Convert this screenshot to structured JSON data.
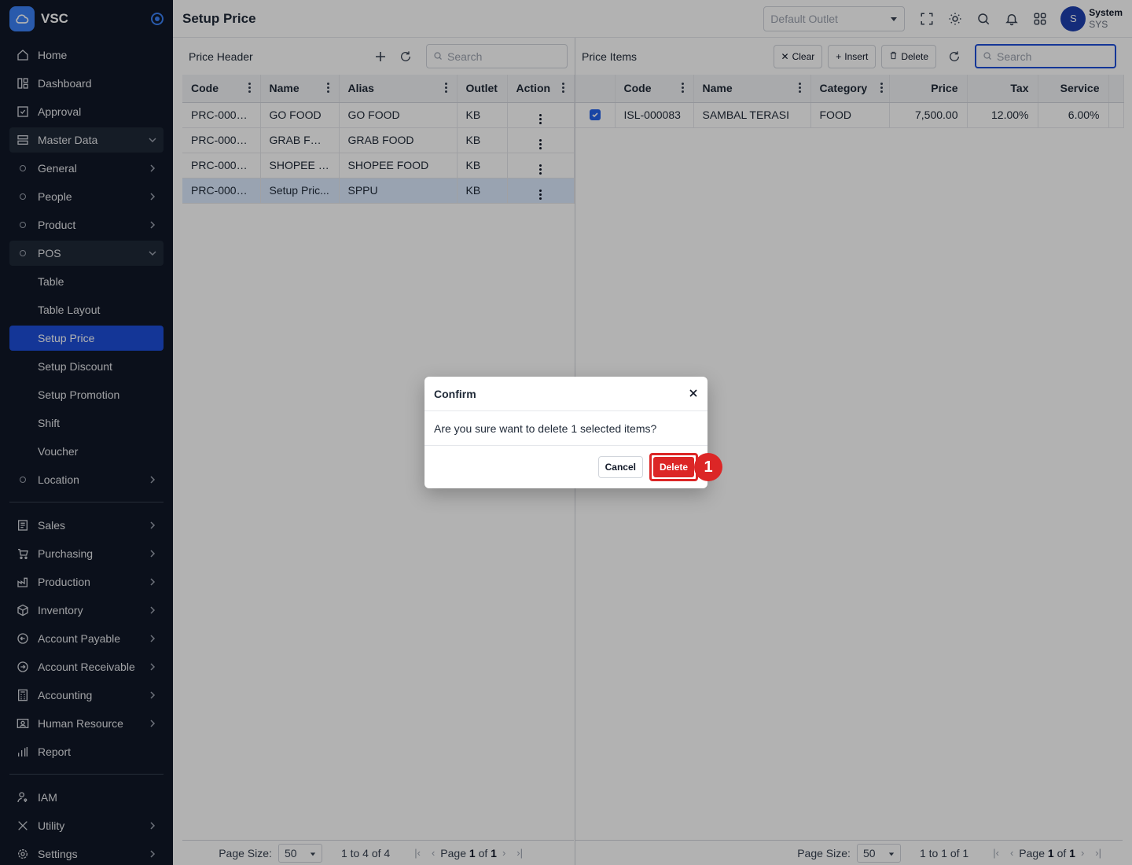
{
  "brand": {
    "name": "VSC"
  },
  "sidebar": {
    "items": [
      {
        "label": "Home",
        "icon": "home-icon"
      },
      {
        "label": "Dashboard",
        "icon": "dashboard-icon"
      },
      {
        "label": "Approval",
        "icon": "approval-icon"
      },
      {
        "label": "Master Data",
        "icon": "database-icon",
        "expanded": true
      },
      {
        "label": "General",
        "sub": true
      },
      {
        "label": "People",
        "sub": true
      },
      {
        "label": "Product",
        "sub": true
      },
      {
        "label": "POS",
        "sub": true,
        "expanded": true
      },
      {
        "label": "Table"
      },
      {
        "label": "Table Layout"
      },
      {
        "label": "Setup Price",
        "active": true
      },
      {
        "label": "Setup Discount"
      },
      {
        "label": "Setup Promotion"
      },
      {
        "label": "Shift"
      },
      {
        "label": "Voucher"
      },
      {
        "label": "Location",
        "sub": true
      }
    ],
    "modules": [
      {
        "label": "Sales",
        "icon": "sales-icon"
      },
      {
        "label": "Purchasing",
        "icon": "cart-icon"
      },
      {
        "label": "Production",
        "icon": "factory-icon"
      },
      {
        "label": "Inventory",
        "icon": "box-icon"
      },
      {
        "label": "Account Payable",
        "icon": "arrow-left-circle-icon"
      },
      {
        "label": "Account Receivable",
        "icon": "arrow-right-circle-icon"
      },
      {
        "label": "Accounting",
        "icon": "calculator-icon"
      },
      {
        "label": "Human Resource",
        "icon": "id-card-icon"
      },
      {
        "label": "Report",
        "icon": "bar-chart-icon"
      }
    ],
    "system": [
      {
        "label": "IAM",
        "icon": "user-key-icon"
      },
      {
        "label": "Utility",
        "icon": "tools-icon"
      },
      {
        "label": "Settings",
        "icon": "gear-icon"
      }
    ]
  },
  "topbar": {
    "title": "Setup Price",
    "outlet_placeholder": "Default Outlet",
    "user_initial": "S",
    "user_name": "System",
    "user_code": "SYS"
  },
  "price_header": {
    "title": "Price Header",
    "search_placeholder": "Search",
    "columns": [
      "Code",
      "Name",
      "Alias",
      "Outlet",
      "Action"
    ],
    "rows": [
      {
        "code": "PRC-0000...",
        "name": "GO FOOD",
        "alias": "GO FOOD",
        "outlet": "KB"
      },
      {
        "code": "PRC-0000...",
        "name": "GRAB FOOD",
        "alias": "GRAB FOOD",
        "outlet": "KB"
      },
      {
        "code": "PRC-0000...",
        "name": "SHOPEE F...",
        "alias": "SHOPEE FOOD",
        "outlet": "KB"
      },
      {
        "code": "PRC-0000...",
        "name": "Setup Pric...",
        "alias": "SPPU",
        "outlet": "KB",
        "selected": true
      }
    ],
    "pager": {
      "page_size_label": "Page Size:",
      "page_size": "50",
      "range": "1 to 4 of 4",
      "page_word": "Page",
      "page": "1",
      "of_word": "of",
      "total_pages": "1"
    }
  },
  "price_items": {
    "title": "Price Items",
    "clear_label": "Clear",
    "insert_label": "Insert",
    "delete_label": "Delete",
    "search_placeholder": "Search",
    "columns": [
      "Code",
      "Name",
      "Category",
      "Price",
      "Tax",
      "Service"
    ],
    "rows": [
      {
        "checked": true,
        "code": "ISL-000083",
        "name": "SAMBAL TERASI",
        "category": "FOOD",
        "price": "7,500.00",
        "tax": "12.00%",
        "service": "6.00%"
      }
    ],
    "pager": {
      "page_size_label": "Page Size:",
      "page_size": "50",
      "range": "1 to 1 of 1",
      "page_word": "Page",
      "page": "1",
      "of_word": "of",
      "total_pages": "1"
    }
  },
  "dialog": {
    "title": "Confirm",
    "message": "Are you sure want to delete 1 selected items?",
    "cancel_label": "Cancel",
    "delete_label": "Delete",
    "step_badge": "1"
  },
  "colors": {
    "sidebar_bg": "#111827",
    "accent": "#1d4ed8",
    "danger": "#dc2626"
  }
}
